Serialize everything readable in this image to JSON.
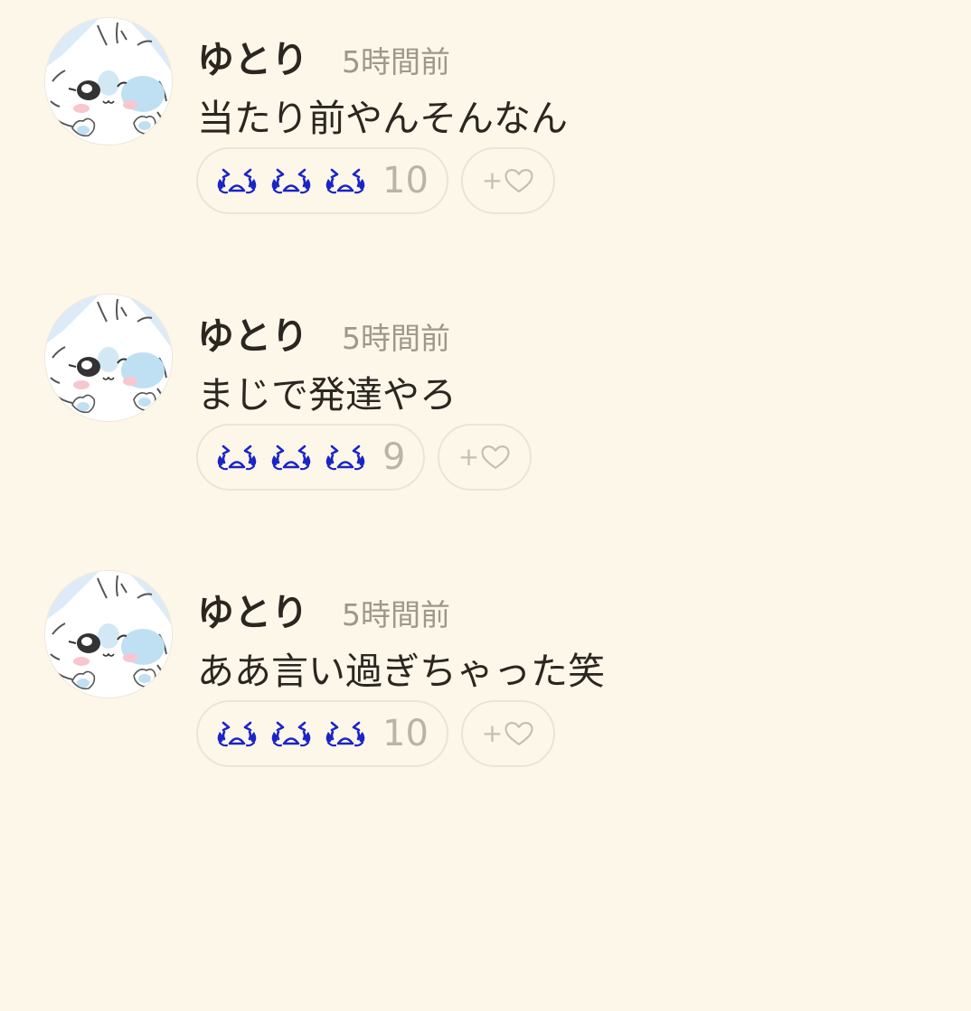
{
  "colors": {
    "background": "#fdf7e9",
    "text": "#2b2620",
    "muted": "#9d9889",
    "count": "#b8b4a6",
    "pill_border": "#ece4d4",
    "emoji_blue": "#1a24c8"
  },
  "comments": [
    {
      "author": "ゆとり",
      "time": "5時間前",
      "text": "当たり前やんそんなん",
      "reaction_icons": [
        "crying-face-icon",
        "crying-face-icon",
        "crying-face-icon"
      ],
      "reaction_count": "10",
      "add_reaction_label": "+",
      "add_reaction_icon": "heart-outline-icon",
      "avatar_icon": "white-rabbit-character-avatar"
    },
    {
      "author": "ゆとり",
      "time": "5時間前",
      "text": "まじで発達やろ",
      "reaction_icons": [
        "crying-face-icon",
        "crying-face-icon",
        "crying-face-icon"
      ],
      "reaction_count": "9",
      "add_reaction_label": "+",
      "add_reaction_icon": "heart-outline-icon",
      "avatar_icon": "white-rabbit-character-avatar"
    },
    {
      "author": "ゆとり",
      "time": "5時間前",
      "text": "ああ言い過ぎちゃった笑",
      "reaction_icons": [
        "crying-face-icon",
        "crying-face-icon",
        "crying-face-icon"
      ],
      "reaction_count": "10",
      "add_reaction_label": "+",
      "add_reaction_icon": "heart-outline-icon",
      "avatar_icon": "white-rabbit-character-avatar"
    }
  ]
}
